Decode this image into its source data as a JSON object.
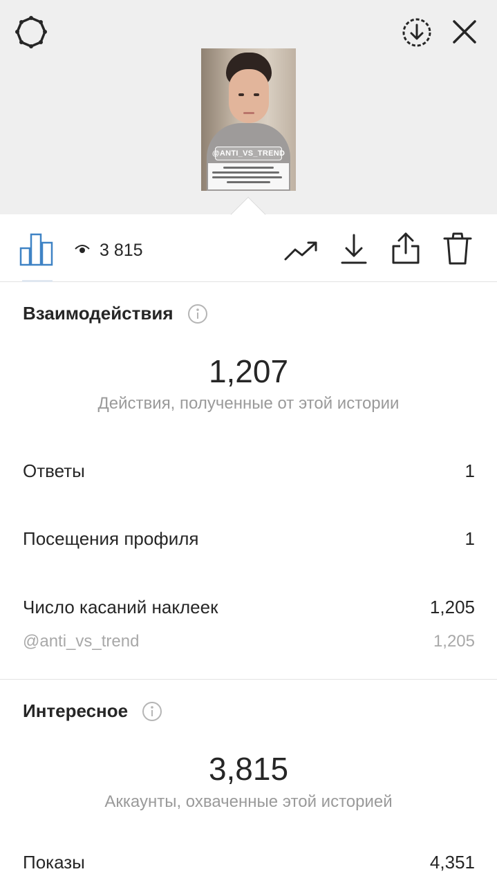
{
  "preview": {
    "sticker_tag": "@ANTI_VS_TREND"
  },
  "toolbar": {
    "views_count": "3 815"
  },
  "interactions": {
    "title": "Взаимодействия",
    "total": "1,207",
    "caption": "Действия, полученные от этой истории",
    "rows": [
      {
        "label": "Ответы",
        "value": "1"
      },
      {
        "label": "Посещения профиля",
        "value": "1"
      },
      {
        "label": "Число касаний наклеек",
        "value": "1,205"
      }
    ],
    "sub_row": {
      "label": "@anti_vs_trend",
      "value": "1,205"
    }
  },
  "discovery": {
    "title": "Интересное",
    "total": "3,815",
    "caption": "Аккаунты, охваченные этой историей",
    "rows": [
      {
        "label": "Показы",
        "value": "4,351"
      }
    ]
  },
  "colors": {
    "accent_blue": "#3f83c5",
    "text": "#262626",
    "muted": "#9a9a9a",
    "top_bg": "#efefef"
  }
}
